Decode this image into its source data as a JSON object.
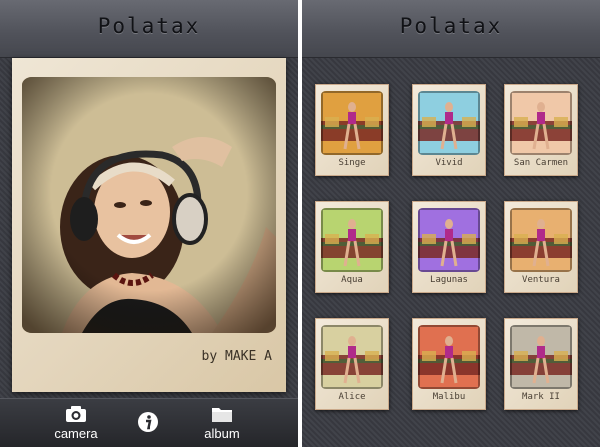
{
  "left_screen": {
    "title": "Polatax",
    "photo_credit": "by MAKE A",
    "toolbar": {
      "camera_label": "camera",
      "album_label": "album"
    }
  },
  "right_screen": {
    "title": "Polatax",
    "filters": [
      {
        "name": "Singe",
        "tint": "#e0a040"
      },
      {
        "name": "Vivid",
        "tint": "#8ecfe0"
      },
      {
        "name": "San Carmen",
        "tint": "#f0c8a8"
      },
      {
        "name": "Aqua",
        "tint": "#b8d470"
      },
      {
        "name": "Lagunas",
        "tint": "#a070e0"
      },
      {
        "name": "Ventura",
        "tint": "#e8b070"
      },
      {
        "name": "Alice",
        "tint": "#d8d0a0"
      },
      {
        "name": "Malibu",
        "tint": "#e07050"
      },
      {
        "name": "Mark II",
        "tint": "#c0b8a8"
      }
    ]
  }
}
